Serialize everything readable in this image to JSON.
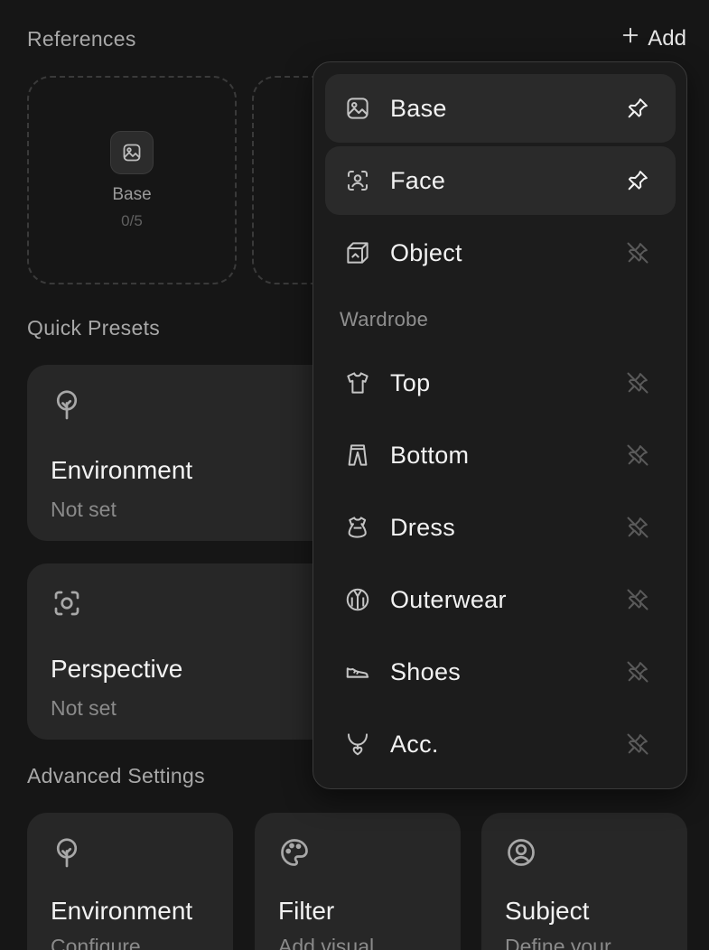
{
  "references": {
    "title": "References",
    "add_label": "Add",
    "slots": [
      {
        "label": "Base",
        "count": "0/5"
      }
    ]
  },
  "quick_presets": {
    "title": "Quick Presets",
    "cards": [
      {
        "title": "Environment",
        "value": "Not set",
        "icon": "tree-icon"
      },
      {
        "title": "Perspective",
        "value": "Not set",
        "icon": "camera-focus-icon"
      }
    ]
  },
  "advanced_settings": {
    "title": "Advanced Settings",
    "cards": [
      {
        "title": "Environment",
        "subtitle": "Configure",
        "icon": "tree-icon"
      },
      {
        "title": "Filter",
        "subtitle": "Add visual",
        "icon": "palette-icon"
      },
      {
        "title": "Subject",
        "subtitle": "Define your",
        "icon": "user-circle-icon"
      }
    ]
  },
  "add_menu": {
    "items": [
      {
        "label": "Base",
        "icon": "image-icon",
        "pinned": true
      },
      {
        "label": "Face",
        "icon": "face-scan-icon",
        "pinned": true
      },
      {
        "label": "Object",
        "icon": "cube-icon",
        "pinned": false
      }
    ],
    "wardrobe_label": "Wardrobe",
    "wardrobe_items": [
      {
        "label": "Top",
        "icon": "shirt-icon",
        "pinned": false
      },
      {
        "label": "Bottom",
        "icon": "pants-icon",
        "pinned": false
      },
      {
        "label": "Dress",
        "icon": "dress-icon",
        "pinned": false
      },
      {
        "label": "Outerwear",
        "icon": "jacket-icon",
        "pinned": false
      },
      {
        "label": "Shoes",
        "icon": "shoe-icon",
        "pinned": false
      },
      {
        "label": "Acc.",
        "icon": "necklace-icon",
        "pinned": false
      }
    ]
  },
  "colors": {
    "background": "#161616",
    "card": "#272727",
    "menu": "#1c1c1c",
    "pinned_row": "#2a2a2a",
    "text_primary": "#f2f2f2",
    "text_muted": "#8a8a8a"
  }
}
